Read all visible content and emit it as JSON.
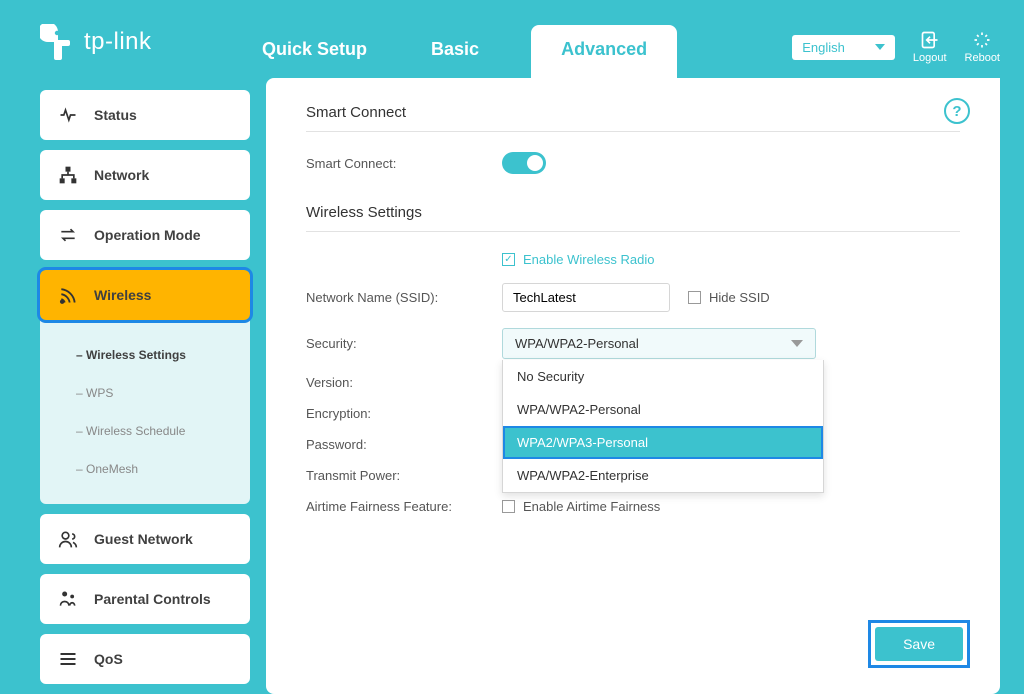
{
  "brand": "tp-link",
  "tabs": {
    "quick": "Quick Setup",
    "basic": "Basic",
    "advanced": "Advanced"
  },
  "header": {
    "language": "English",
    "logout": "Logout",
    "reboot": "Reboot"
  },
  "nav": {
    "status": "Status",
    "network": "Network",
    "operation": "Operation Mode",
    "wireless": "Wireless",
    "guest": "Guest Network",
    "parental": "Parental Controls",
    "qos": "QoS"
  },
  "subnav": {
    "wset": "Wireless Settings",
    "wps": "WPS",
    "wsched": "Wireless Schedule",
    "onemesh": "OneMesh"
  },
  "panel": {
    "smart_title": "Smart Connect",
    "smart_label": "Smart Connect:",
    "wireless_title": "Wireless Settings",
    "enable_radio": "Enable Wireless Radio",
    "ssid_label": "Network Name (SSID):",
    "ssid_value": "TechLatest",
    "hide_ssid": "Hide SSID",
    "security_label": "Security:",
    "security_value": "WPA/WPA2-Personal",
    "version_label": "Version:",
    "encryption_label": "Encryption:",
    "password_label": "Password:",
    "transmit_label": "Transmit Power:",
    "airtime_label": "Airtime Fairness Feature:",
    "airtime_check": "Enable Airtime Fairness",
    "save": "Save"
  },
  "security_options": {
    "o1": "No Security",
    "o2": "WPA/WPA2-Personal",
    "o3": "WPA2/WPA3-Personal",
    "o4": "WPA/WPA2-Enterprise"
  }
}
